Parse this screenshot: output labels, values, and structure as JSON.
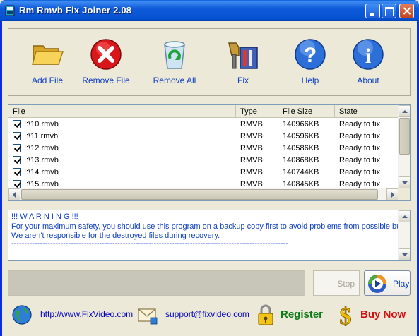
{
  "window": {
    "title": "Rm Rmvb Fix Joiner 2.08"
  },
  "toolbar": {
    "add_file": "Add File",
    "remove_file": "Remove File",
    "remove_all": "Remove All",
    "fix": "Fix",
    "help": "Help",
    "about": "About"
  },
  "list": {
    "columns": [
      "File",
      "Type",
      "File Size",
      "State"
    ],
    "rows": [
      {
        "file": "I:\\10.rmvb",
        "type": "RMVB",
        "size": "140966KB",
        "state": "Ready to fix",
        "checked": true
      },
      {
        "file": "I:\\11.rmvb",
        "type": "RMVB",
        "size": "140596KB",
        "state": "Ready to fix",
        "checked": true
      },
      {
        "file": "I:\\12.rmvb",
        "type": "RMVB",
        "size": "140586KB",
        "state": "Ready to fix",
        "checked": true
      },
      {
        "file": "I:\\13.rmvb",
        "type": "RMVB",
        "size": "140868KB",
        "state": "Ready to fix",
        "checked": true
      },
      {
        "file": "I:\\14.rmvb",
        "type": "RMVB",
        "size": "140744KB",
        "state": "Ready to fix",
        "checked": true
      },
      {
        "file": "I:\\15.rmvb",
        "type": "RMVB",
        "size": "140845KB",
        "state": "Ready to fix",
        "checked": true
      }
    ]
  },
  "warning": {
    "lines": [
      "!!! W A R N I N G !!!",
      "For your maximum safety, you should use this program on a backup copy first to avoid problems from possible bugs.",
      "We aren't responsible for the destroyed files during recovery.",
      "-----------------------------------------------------------------------------------------------------------"
    ]
  },
  "controls": {
    "stop": "Stop",
    "play": "Play"
  },
  "footer": {
    "website": "http://www.FixVideo.com",
    "email": "support@fixvideo.com",
    "register": "Register",
    "buy_now": "Buy Now"
  },
  "colors": {
    "link_blue": "#1040c0",
    "register_green": "#0c7a16",
    "buy_red": "#d61010",
    "titlebar_blue": "#0552d2"
  },
  "icons": [
    "app-icon",
    "folder-open-icon",
    "remove-x-icon",
    "recycle-bin-icon",
    "fix-tools-icon",
    "help-question-icon",
    "about-info-icon",
    "play-icon",
    "globe-icon",
    "envelope-icon",
    "padlock-key-icon",
    "dollar-icon"
  ]
}
